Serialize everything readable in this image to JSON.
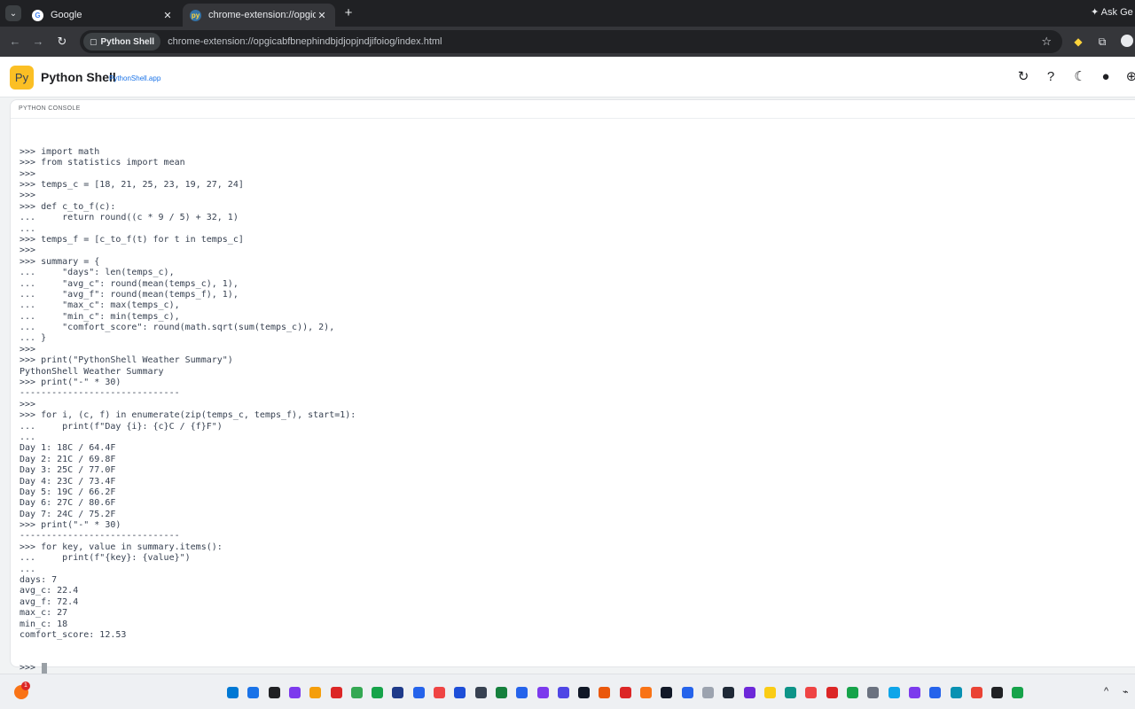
{
  "browser": {
    "tabs": [
      {
        "title": "Google",
        "icon": "google-icon"
      },
      {
        "title": "chrome-extension://opgicabfbn",
        "icon": "python-icon"
      }
    ],
    "ask_gemini": "Ask Ge",
    "origin_chip": "Python Shell",
    "url": "chrome-extension://opgicabfbnephindbjdjopjndjifoiog/index.html"
  },
  "app": {
    "logo": "Py",
    "title": "Python Shell",
    "subtitle": "PythonShell.app"
  },
  "console": {
    "label": "PYTHON CONSOLE",
    "lines": [
      ">>> import math",
      ">>> from statistics import mean",
      ">>>",
      ">>> temps_c = [18, 21, 25, 23, 19, 27, 24]",
      ">>>",
      ">>> def c_to_f(c):",
      "...     return round((c * 9 / 5) + 32, 1)",
      "...",
      ">>> temps_f = [c_to_f(t) for t in temps_c]",
      ">>>",
      ">>> summary = {",
      "...     \"days\": len(temps_c),",
      "...     \"avg_c\": round(mean(temps_c), 1),",
      "...     \"avg_f\": round(mean(temps_f), 1),",
      "...     \"max_c\": max(temps_c),",
      "...     \"min_c\": min(temps_c),",
      "...     \"comfort_score\": round(math.sqrt(sum(temps_c)), 2),",
      "... }",
      ">>>",
      ">>> print(\"PythonShell Weather Summary\")",
      "PythonShell Weather Summary",
      ">>> print(\"-\" * 30)",
      "------------------------------",
      ">>>",
      ">>> for i, (c, f) in enumerate(zip(temps_c, temps_f), start=1):",
      "...     print(f\"Day {i}: {c}C / {f}F\")",
      "...",
      "Day 1: 18C / 64.4F",
      "Day 2: 21C / 69.8F",
      "Day 3: 25C / 77.0F",
      "Day 4: 23C / 73.4F",
      "Day 5: 19C / 66.2F",
      "Day 6: 27C / 80.6F",
      "Day 7: 24C / 75.2F",
      ">>> print(\"-\" * 30)",
      "------------------------------",
      ">>> for key, value in summary.items():",
      "...     print(f\"{key}: {value}\")",
      "...",
      "days: 7",
      "avg_c: 22.4",
      "avg_f: 72.4",
      "max_c: 27",
      "min_c: 18",
      "comfort_score: 12.53"
    ],
    "prompt": ">>> "
  },
  "taskbar": {
    "weather_badge": "1",
    "icon_colors": [
      "#0078d4",
      "#1a73e8",
      "#202124",
      "#7c3aed",
      "#f59e0b",
      "#dc2626",
      "#34a853",
      "#16a34a",
      "#1e3a8a",
      "#2563eb",
      "#ef4444",
      "#1d4ed8",
      "#374151",
      "#15803d",
      "#2563eb",
      "#7c3aed",
      "#4f46e5",
      "#111827",
      "#ea580c",
      "#dc2626",
      "#f97316",
      "#111827",
      "#2563eb",
      "#9ca3af",
      "#1f2937",
      "#6d28d9",
      "#facc15",
      "#0d9488",
      "#ef4444",
      "#dc2626",
      "#16a34a",
      "#6b7280",
      "#0ea5e9",
      "#7c3aed",
      "#2563eb",
      "#0891b2",
      "#ea4335",
      "#202124",
      "#16a34a"
    ]
  }
}
